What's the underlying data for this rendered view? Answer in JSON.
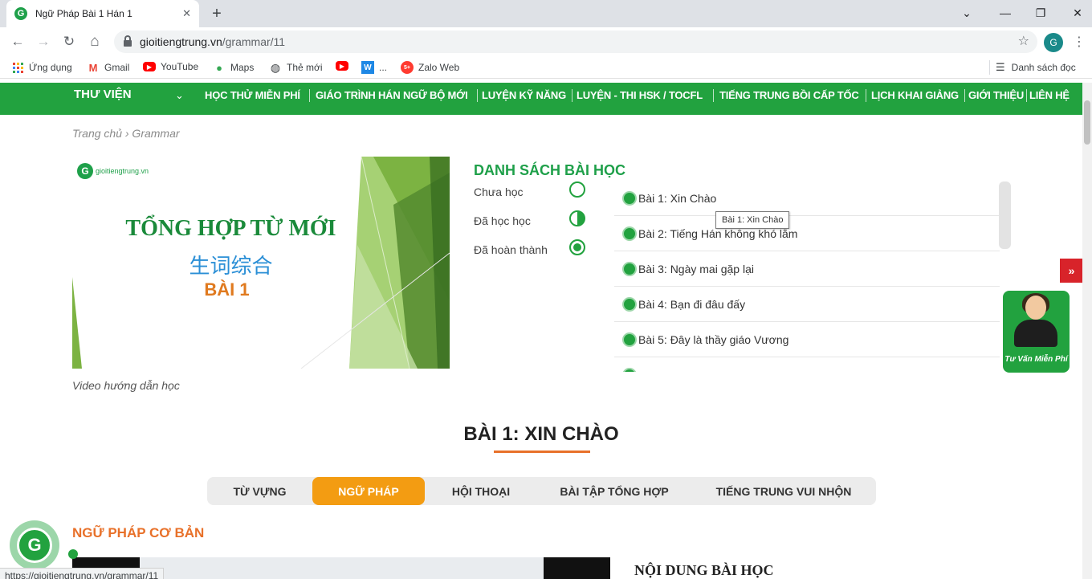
{
  "browser": {
    "tab_title": "Ngữ Pháp Bài 1 Hán 1",
    "tab_favicon": "G",
    "close_glyph": "✕",
    "new_tab_glyph": "+",
    "minimize_glyph": "⌄",
    "restore_glyph": "—",
    "maximize_glyph": "❐",
    "close_window_glyph": "✕",
    "back_glyph": "←",
    "forward_glyph": "→",
    "reload_glyph": "↻",
    "home_glyph": "⌂",
    "url_host": "gioitiengtrung.vn",
    "url_path": "/grammar/11",
    "star_glyph": "☆",
    "profile_initial": "G",
    "menu_glyph": "⋮",
    "status_url": "https://gioitiengtrung.vn/grammar/11"
  },
  "bookmarks": {
    "items": [
      {
        "label": "Ứng dụng",
        "icon": "apps-grid-icon"
      },
      {
        "label": "Gmail",
        "icon": "gmail-icon"
      },
      {
        "label": "YouTube",
        "icon": "youtube-icon"
      },
      {
        "label": "Maps",
        "icon": "maps-icon"
      },
      {
        "label": "Thẻ mới",
        "icon": "globe-icon"
      },
      {
        "label": "",
        "icon": "youtube-icon"
      },
      {
        "label": "...",
        "icon": "word-icon"
      },
      {
        "label": "Zalo Web",
        "icon": "zalo-icon"
      }
    ],
    "glyphs": {
      "gmail": "M",
      "youtube": "▶",
      "maps": "●",
      "globe": "◍",
      "word": "W",
      "zalo": "5+"
    },
    "reading_list": "Danh sách đọc",
    "reading_list_glyph": "☰"
  },
  "site_nav": {
    "library": "THƯ VIỆN",
    "chevron": "⌄",
    "items": [
      "HỌC THỬ MIỄN PHÍ",
      "GIÁO TRÌNH HÁN NGỮ BỘ MỚI",
      "LUYỆN KỸ NĂNG",
      "LUYỆN - THI HSK / TOCFL",
      "TIẾNG TRUNG BỒI CẤP TỐC",
      "LỊCH KHAI GIẢNG",
      "GIỚI THIỆU",
      "LIÊN HỆ"
    ]
  },
  "breadcrumb": "Trang chủ › Grammar",
  "hero": {
    "logo_initial": "G",
    "logo_text": "gioitiengtrung.vn",
    "title": "TỔNG HỢP TỪ MỚI",
    "chinese": "生词综合",
    "lesson": "BÀI 1",
    "caption": "Video hướng dẫn học"
  },
  "lesson_panel": {
    "title": "DANH SÁCH BÀI HỌC",
    "legend": [
      "Chưa học",
      "Đã học học",
      "Đã hoàn thành"
    ],
    "lessons": [
      "Bài 1: Xin Chào",
      "Bài 2: Tiếng Hán không khó lắm",
      "Bài 3: Ngày mai gặp lại",
      "Bài 4: Bạn đi đâu đấy",
      "Bài 5: Đây là thầy giáo Vương"
    ],
    "tooltip": "Bài 1: Xin Chào"
  },
  "side": {
    "toggle_glyph": "»",
    "consult_text": "Tư Vấn Miễn Phí"
  },
  "main": {
    "section_title": "BÀI 1: XIN CHÀO",
    "tabs": [
      "TỪ VỰNG",
      "NGỮ PHÁP",
      "HỘI THOẠI",
      "BÀI TẬP TỔNG HỢP",
      "TIẾNG TRUNG VUI NHỘN"
    ],
    "active_tab": 1,
    "subhead": "NGỮ PHÁP CƠ BẢN",
    "content_head": "NỘI DUNG BÀI HỌC",
    "fab_initial": "G"
  },
  "colors": {
    "brand_green": "#22a23f",
    "accent_orange": "#f39c12",
    "heading_orange": "#e8712a",
    "alert_red": "#d8232a"
  }
}
